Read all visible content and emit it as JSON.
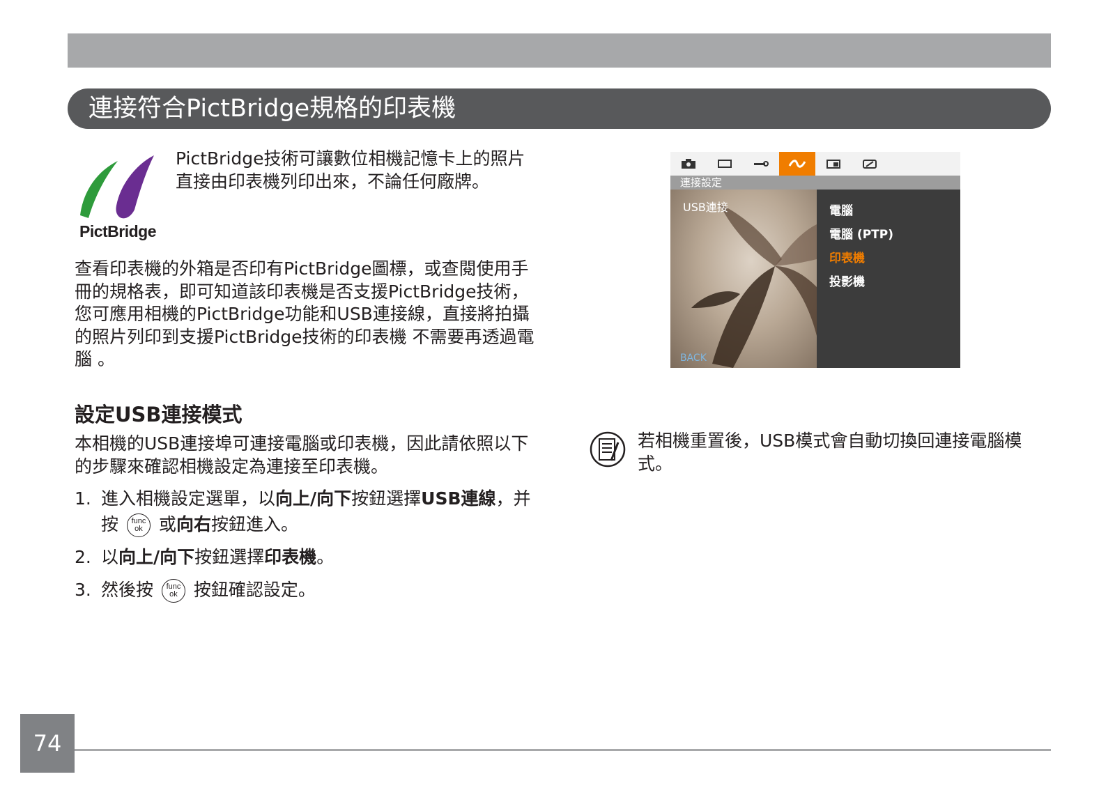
{
  "header": {
    "title": "連接符合PictBridge規格的印表機"
  },
  "logo": {
    "text": "PictBridge",
    "colors": {
      "green": "#2e9b3b",
      "purple": "#6a2d91"
    }
  },
  "intro": {
    "text": "PictBridge技術可讓數位相機記憶卡上的照片直接由印表機列印出來，不論任何廠牌。"
  },
  "paragraph2": {
    "text": "查看印表機的外箱是否印有PictBridge圖標，或查閱使用手冊的規格表，即可知道該印表機是否支援PictBridge技術，您可應用相機的PictBridge功能和USB連接線，直接將拍攝的照片列印到支援PictBridge技術的印表機 不需要再透過電腦 。"
  },
  "section": {
    "heading": "設定USB連接模式",
    "text": "本相機的USB連接埠可連接電腦或印表機，因此請依照以下的步驟來確認相機設定為連接至印表機。"
  },
  "steps": [
    {
      "num": "1.",
      "t1": "進入相機設定選單，以",
      "b1": "向上/向下",
      "t2": "按鈕選擇",
      "b2": "USB連線",
      "t3": "，并按",
      "t4": "或",
      "b3": "向右",
      "t5": "按鈕進入。"
    },
    {
      "num": "2.",
      "t1": "以",
      "b1": "向上/向下",
      "t2": "按鈕選擇",
      "b2": "印表機",
      "t3": "。"
    },
    {
      "num": "3.",
      "t1": "然後按",
      "t2": "按鈕確認設定。"
    }
  ],
  "func_button": {
    "top": "func",
    "bottom": "ok"
  },
  "camera_screen": {
    "menu_title": "連接設定",
    "left_item": "USB連接",
    "options": [
      "電腦",
      "電腦 (PTP)",
      "印表機",
      "投影機"
    ],
    "selected_option": "印表機",
    "back_label": "BACK",
    "accent_color": "#f07d00"
  },
  "note": {
    "text": "若相機重置後，USB模式會自動切換回連接電腦模式。"
  },
  "page_number": "74"
}
